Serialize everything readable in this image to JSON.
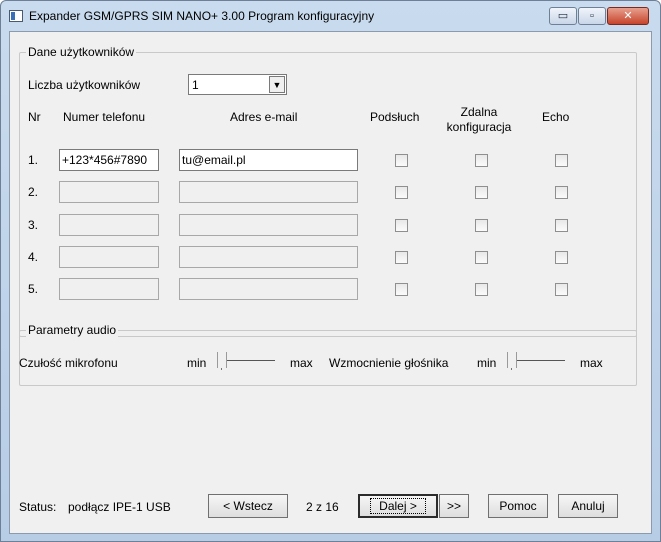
{
  "window": {
    "title": "Expander GSM/GPRS SIM NANO+ 3.00 Program konfiguracyjny"
  },
  "titlebar_buttons": {
    "minimize": "▭",
    "maximize": "▫",
    "close": "✕"
  },
  "users_group": {
    "title": "Dane użytkowników",
    "count_label": "Liczba użytkowników",
    "count_value": "1",
    "columns": {
      "nr": "Nr",
      "phone": "Numer telefonu",
      "email": "Adres e-mail",
      "listen": "Podsłuch",
      "remote_config": "Zdalna\nkonfiguracja",
      "echo": "Echo"
    },
    "rows": [
      {
        "nr": "1.",
        "phone": "+123*456#7890",
        "email": "tu@email.pl"
      },
      {
        "nr": "2.",
        "phone": "",
        "email": ""
      },
      {
        "nr": "3.",
        "phone": "",
        "email": ""
      },
      {
        "nr": "4.",
        "phone": "",
        "email": ""
      },
      {
        "nr": "5.",
        "phone": "",
        "email": ""
      }
    ]
  },
  "audio_group": {
    "title": "Parametry audio",
    "mic_label": "Czułość mikrofonu",
    "speaker_label": "Wzmocnienie głośnika",
    "min_label": "min",
    "max_label": "max",
    "mic_level": 0,
    "speaker_level": 0
  },
  "footer": {
    "status_label": "Status:",
    "status_value": "podłącz IPE-1 USB",
    "back_button": "< Wstecz",
    "page_indicator": "2 z 16",
    "next_button": "Dalej >",
    "last_button": ">>",
    "help_button": "Pomoc",
    "cancel_button": "Anuluj"
  }
}
